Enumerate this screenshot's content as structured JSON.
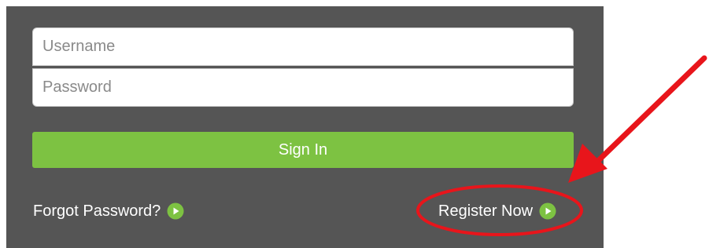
{
  "login": {
    "username": {
      "placeholder": "Username",
      "value": ""
    },
    "password": {
      "placeholder": "Password",
      "value": ""
    },
    "sign_in_label": "Sign In",
    "forgot_password_label": "Forgot Password?",
    "register_label": "Register Now"
  },
  "icons": {
    "link_arrow": "play-circle-icon",
    "annotation_arrow": "red-arrow",
    "annotation_highlight": "red-ellipse"
  },
  "colors": {
    "panel_background": "#555555",
    "sign_in_button": "#7dc242",
    "link_icon": "#7dc242",
    "link_text": "#ffffff",
    "annotation": "#e8151b"
  }
}
